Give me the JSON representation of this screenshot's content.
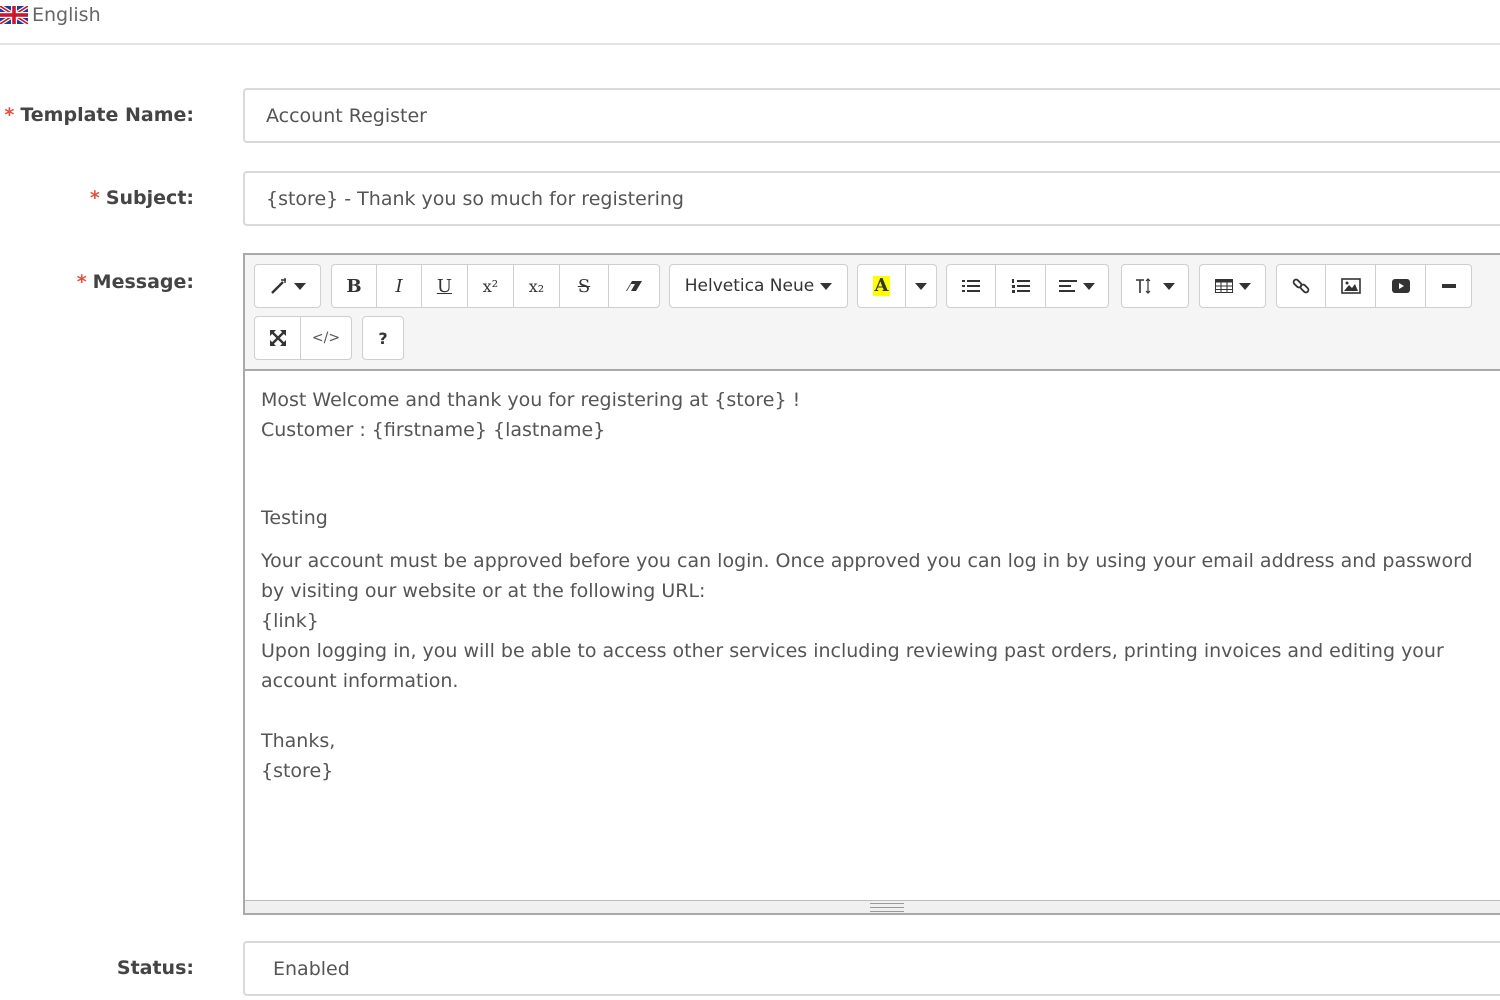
{
  "language_tab": {
    "label": "English",
    "flag_icon": "uk-flag-icon"
  },
  "form": {
    "template_name": {
      "label": "Template Name:",
      "value": "Account Register"
    },
    "subject": {
      "label": "Subject:",
      "value": "{store} - Thank you so much for registering"
    },
    "message": {
      "label": "Message:"
    },
    "status": {
      "label": "Status:",
      "value": "Enabled"
    },
    "required_mark": "*"
  },
  "toolbar": {
    "font_name": "Helvetica Neue",
    "color_button_glyph": "A",
    "help_glyph": "?"
  },
  "message_body": {
    "line1": "Most Welcome and thank you for registering at {store} !",
    "line2": "Customer : {firstname} {lastname}",
    "line3": "Testing",
    "line4": "Your account must be approved before you can login. Once approved you can log in by using your email address and password by visiting our website or at the following URL:",
    "line5": "{link}",
    "line6": "Upon logging in, you will be able to access other services including reviewing past orders, printing invoices and editing your account information.",
    "line7": "Thanks,",
    "line8": "{store}"
  },
  "colors": {
    "required": "#e3503e",
    "highlight": "#ffff00"
  }
}
